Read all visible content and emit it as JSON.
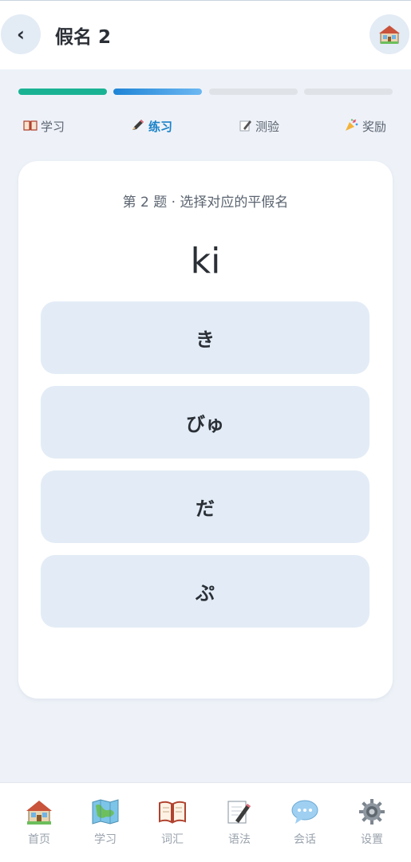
{
  "header": {
    "back_label": "‹",
    "title": "假名 2"
  },
  "progress": {
    "segments": [
      {
        "state": "done",
        "color": "#19b394"
      },
      {
        "state": "current",
        "color": "#2b8fe0"
      },
      {
        "state": "todo",
        "color": "#dfe3e8"
      },
      {
        "state": "todo",
        "color": "#dfe3e8"
      }
    ]
  },
  "tabs": [
    {
      "label": "学习",
      "icon": "book-icon",
      "active": false
    },
    {
      "label": "练习",
      "icon": "pencil-icon",
      "active": true
    },
    {
      "label": "测验",
      "icon": "memo-icon",
      "active": false
    },
    {
      "label": "奖励",
      "icon": "party-popper-icon",
      "active": false
    }
  ],
  "quiz": {
    "question": "第 2 题 · 选择对应的平假名",
    "prompt": "ki",
    "options": [
      "き",
      "びゅ",
      "だ",
      "ぷ"
    ]
  },
  "bottom_nav": [
    {
      "label": "首页",
      "icon": "house-icon"
    },
    {
      "label": "学习",
      "icon": "map-icon"
    },
    {
      "label": "词汇",
      "icon": "open-book-icon"
    },
    {
      "label": "语法",
      "icon": "memo-icon"
    },
    {
      "label": "会话",
      "icon": "speech-bubble-icon"
    },
    {
      "label": "设置",
      "icon": "gear-icon"
    }
  ],
  "colors": {
    "accent": "#1b82c8",
    "background": "#eef2f8",
    "option_bg": "#e3ecf6"
  }
}
